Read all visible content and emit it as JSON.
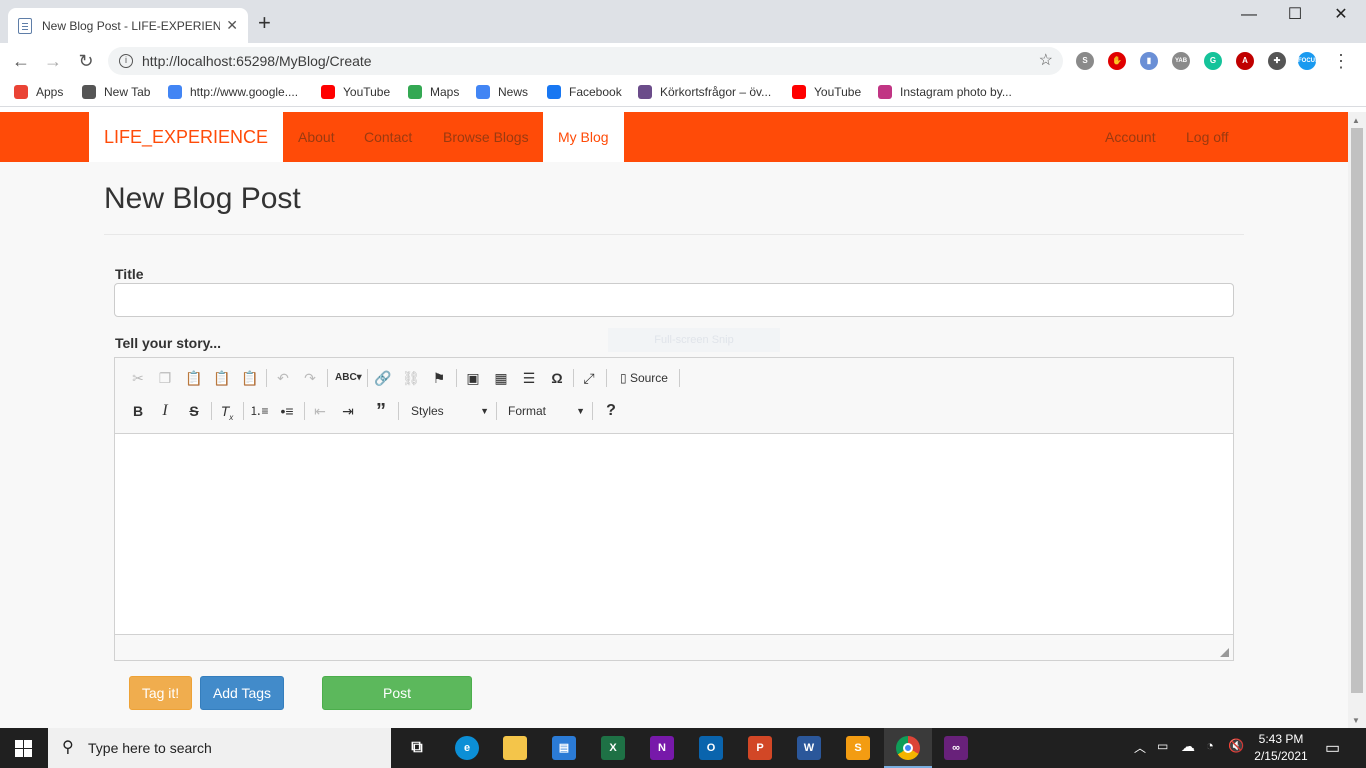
{
  "browser": {
    "tab_title": "New Blog Post - LIFE-EXPERIENCE",
    "tab_close": "✕",
    "new_tab": "+",
    "win_minimize": "—",
    "win_maximize": "☐",
    "win_close": "✕",
    "back": "←",
    "forward": "→",
    "reload": "↻",
    "url": "http://localhost:65298/MyBlog/Create",
    "star": "☆",
    "extensions": [
      {
        "name": "skype-ext-icon",
        "glyph": "S",
        "color": "#8a8a8a"
      },
      {
        "name": "adblock-ext-icon",
        "glyph": "✋",
        "color": "#e00000"
      },
      {
        "name": "phone-ext-icon",
        "glyph": "▮",
        "color": "#6a8fd6"
      },
      {
        "name": "yab-ext-icon",
        "glyph": "YAB",
        "color": "#8a8a8a"
      },
      {
        "name": "grammarly-ext-icon",
        "glyph": "G",
        "color": "#15c39a"
      },
      {
        "name": "pdf-ext-icon",
        "glyph": "A",
        "color": "#c00000"
      },
      {
        "name": "puzzle-ext-icon",
        "glyph": "✚",
        "color": "#555"
      },
      {
        "name": "focus-ext-icon",
        "glyph": "FOCUS",
        "color": "#1a9af0"
      }
    ],
    "menu": "⋮"
  },
  "bookmarks": [
    {
      "label": "Apps",
      "icon": "apps-grid-icon",
      "color": "#ea4335"
    },
    {
      "label": "New Tab",
      "icon": "globe-icon",
      "color": "#555"
    },
    {
      "label": "http://www.google....",
      "icon": "google-icon",
      "color": "#4285f4"
    },
    {
      "label": "YouTube",
      "icon": "youtube-icon",
      "color": "#f00"
    },
    {
      "label": "Maps",
      "icon": "maps-pin-icon",
      "color": "#34a853"
    },
    {
      "label": "News",
      "icon": "news-icon",
      "color": "#4285f4"
    },
    {
      "label": "Facebook",
      "icon": "facebook-icon",
      "color": "#1877f2"
    },
    {
      "label": "Körkortsfrågor – öv...",
      "icon": "flag-icon",
      "color": "#6b4c8a"
    },
    {
      "label": "YouTube",
      "icon": "youtube-icon",
      "color": "#f00"
    },
    {
      "label": "Instagram photo by...",
      "icon": "instagram-icon",
      "color": "#c13584"
    }
  ],
  "navbar": {
    "brand": "LIFE_EXPERIENCE",
    "links": [
      "About",
      "Contact",
      "Browse Blogs",
      "My Blog"
    ],
    "right_links": [
      "Account",
      "Log off"
    ],
    "color": "#ff4b08"
  },
  "main": {
    "heading": "New Blog Post",
    "title_label": "Title",
    "title_value": "",
    "story_label": "Tell your story...",
    "snip_overlay": "Full-screen Snip"
  },
  "editor": {
    "source_label": "Source",
    "styles_label": "Styles",
    "format_label": "Format",
    "body_text": ""
  },
  "buttons": {
    "tag": "Tag it!",
    "add_tags": "Add Tags",
    "post": "Post"
  },
  "taskbar": {
    "search_placeholder": "Type here to search",
    "time": "5:43 PM",
    "date": "2/15/2021"
  }
}
